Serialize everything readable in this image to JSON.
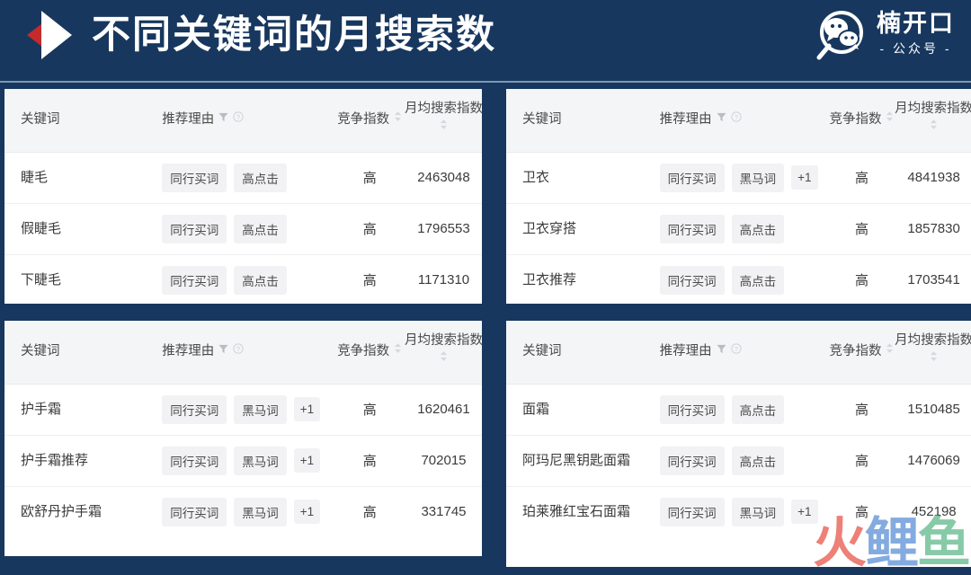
{
  "header": {
    "title": "不同关键词的月搜索数",
    "logo_mark": "play-triangle-logo",
    "brand": {
      "icon": "wechat-magnifier-icon",
      "name": "楠开口",
      "sub": "- 公众号 -"
    }
  },
  "columns": {
    "keyword": "关键词",
    "reason": "推荐理由",
    "competition": "竞争指数",
    "search_index": "月均搜索指数",
    "filter_icon": "filter-icon",
    "help_icon": "help-circle-icon",
    "sort_icon": "sort-arrows-icon"
  },
  "colors": {
    "background": "#17375e",
    "panel": "#ffffff",
    "header_row": "#f4f5f7",
    "tag_bg": "#f2f2f4",
    "title_text": "#ffffff",
    "logo_red": "#c42b2b",
    "divider": "#8fa9c4"
  },
  "tables": [
    {
      "id": "eyelash",
      "rows": [
        {
          "keyword": "睫毛",
          "tags": [
            "同行买词",
            "高点击"
          ],
          "competition": "高",
          "search_index": "2463048"
        },
        {
          "keyword": "假睫毛",
          "tags": [
            "同行买词",
            "高点击"
          ],
          "competition": "高",
          "search_index": "1796553"
        },
        {
          "keyword": "下睫毛",
          "tags": [
            "同行买词",
            "高点击"
          ],
          "competition": "高",
          "search_index": "1171310"
        }
      ]
    },
    {
      "id": "hoodie",
      "rows": [
        {
          "keyword": "卫衣",
          "tags": [
            "同行买词",
            "黑马词",
            "+1"
          ],
          "competition": "高",
          "search_index": "4841938"
        },
        {
          "keyword": "卫衣穿搭",
          "tags": [
            "同行买词",
            "高点击"
          ],
          "competition": "高",
          "search_index": "1857830"
        },
        {
          "keyword": "卫衣推荐",
          "tags": [
            "同行买词",
            "高点击"
          ],
          "competition": "高",
          "search_index": "1703541"
        }
      ]
    },
    {
      "id": "handcream",
      "rows": [
        {
          "keyword": "护手霜",
          "tags": [
            "同行买词",
            "黑马词",
            "+1"
          ],
          "competition": "高",
          "search_index": "1620461"
        },
        {
          "keyword": "护手霜推荐",
          "tags": [
            "同行买词",
            "黑马词",
            "+1"
          ],
          "competition": "高",
          "search_index": "702015"
        },
        {
          "keyword": "欧舒丹护手霜",
          "tags": [
            "同行买词",
            "黑马词",
            "+1"
          ],
          "competition": "高",
          "search_index": "331745"
        }
      ]
    },
    {
      "id": "facecream",
      "rows": [
        {
          "keyword": "面霜",
          "tags": [
            "同行买词",
            "高点击"
          ],
          "competition": "高",
          "search_index": "1510485"
        },
        {
          "keyword": "阿玛尼黑钥匙面霜",
          "tags": [
            "同行买词",
            "高点击"
          ],
          "competition": "高",
          "search_index": "1476069"
        },
        {
          "keyword": "珀莱雅红宝石面霜",
          "tags": [
            "同行买词",
            "黑马词",
            "+1"
          ],
          "competition": "高",
          "search_index": "452198"
        }
      ]
    }
  ],
  "watermark": {
    "char1": "火",
    "char2": "鲤",
    "char3": "鱼"
  }
}
